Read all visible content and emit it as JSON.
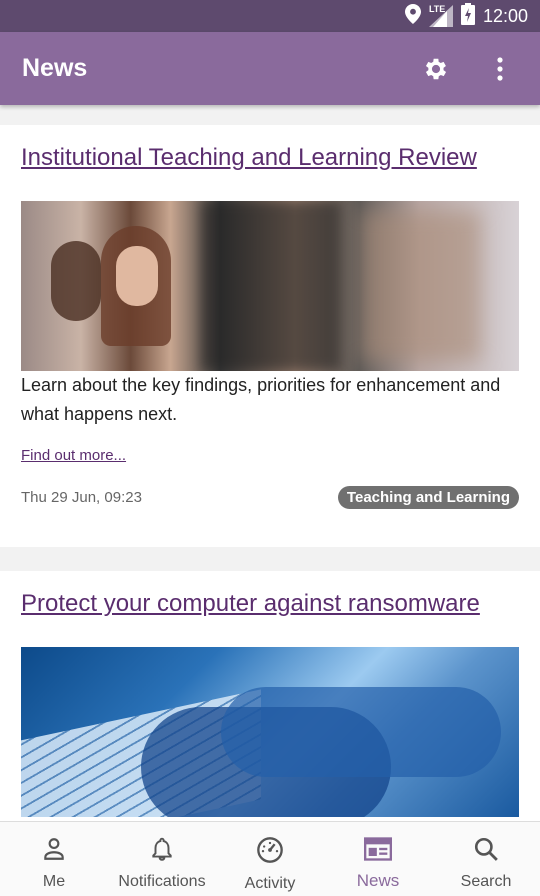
{
  "status": {
    "network": "LTE",
    "time": "12:00"
  },
  "appbar": {
    "title": "News",
    "settings_icon": "gear-icon",
    "menu_icon": "more-vert-icon"
  },
  "articles": [
    {
      "title": "Institutional Teaching and Learning Review",
      "image": "classroom-photo",
      "summary": "Learn about the key findings, priorities for enhancement and what happens next.",
      "more": "Find out more...",
      "date": "Thu 29 Jun, 09:23",
      "tag": "Teaching and Learning"
    },
    {
      "title": "Protect your computer against ransomware",
      "image": "keyboard-photo"
    }
  ],
  "nav": [
    {
      "label": "Me",
      "icon": "person-icon"
    },
    {
      "label": "Notifications",
      "icon": "bell-icon"
    },
    {
      "label": "Activity",
      "icon": "gauge-icon"
    },
    {
      "label": "News",
      "icon": "newspaper-icon",
      "active": true
    },
    {
      "label": "Search",
      "icon": "search-icon"
    }
  ],
  "colors": {
    "appbar": "#8a6a9c",
    "statusbar": "#5e4a6e",
    "link": "#5a2d6e",
    "tag_bg": "#707070"
  }
}
